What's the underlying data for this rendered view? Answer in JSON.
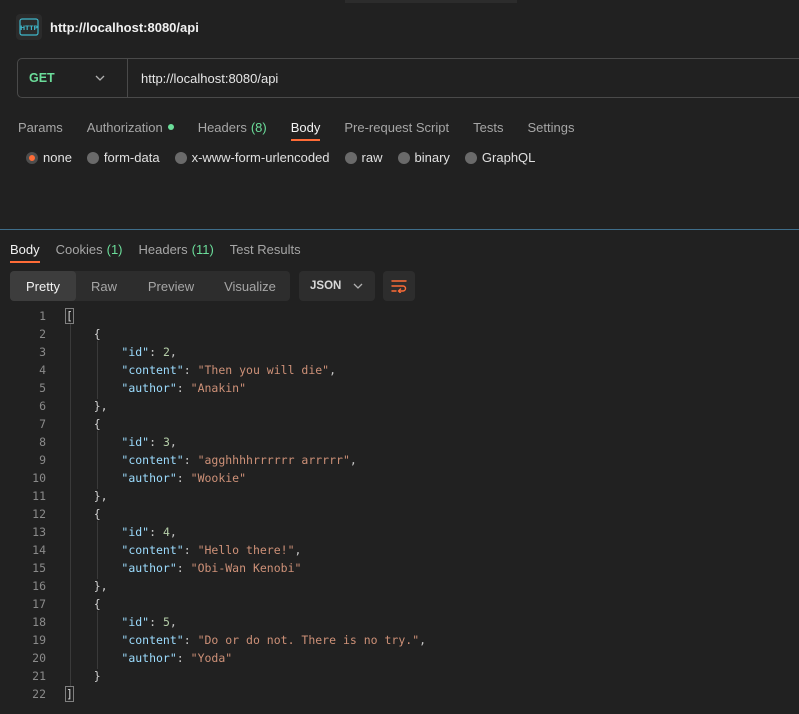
{
  "window": {
    "title": "http://localhost:8080/api",
    "icon": "http-icon"
  },
  "request": {
    "method": "GET",
    "url": "http://localhost:8080/api",
    "tabs": [
      {
        "label": "Params"
      },
      {
        "label": "Authorization",
        "indicator": "green-dot"
      },
      {
        "label": "Headers",
        "count": "(8)"
      },
      {
        "label": "Body",
        "active": true
      },
      {
        "label": "Pre-request Script"
      },
      {
        "label": "Tests"
      },
      {
        "label": "Settings"
      }
    ],
    "body_types": [
      {
        "label": "none",
        "checked": true
      },
      {
        "label": "form-data"
      },
      {
        "label": "x-www-form-urlencoded"
      },
      {
        "label": "raw"
      },
      {
        "label": "binary"
      },
      {
        "label": "GraphQL"
      }
    ]
  },
  "response": {
    "tabs": [
      {
        "label": "Body",
        "active": true
      },
      {
        "label": "Cookies",
        "count": "(1)"
      },
      {
        "label": "Headers",
        "count": "(11)"
      },
      {
        "label": "Test Results"
      }
    ],
    "view_modes": [
      "Pretty",
      "Raw",
      "Preview",
      "Visualize"
    ],
    "active_view": "Pretty",
    "format": "JSON",
    "lines": [
      {
        "n": "1",
        "text": "["
      },
      {
        "n": "2",
        "text": "    {"
      },
      {
        "n": "3",
        "key": "\"id\"",
        "num": "2",
        "indent": "        "
      },
      {
        "n": "4",
        "key": "\"content\"",
        "str": "\"Then you will die\"",
        "indent": "        "
      },
      {
        "n": "5",
        "key": "\"author\"",
        "str": "\"Anakin\"",
        "indent": "        ",
        "last": true
      },
      {
        "n": "6",
        "text": "    },"
      },
      {
        "n": "7",
        "text": "    {"
      },
      {
        "n": "8",
        "key": "\"id\"",
        "num": "3",
        "indent": "        "
      },
      {
        "n": "9",
        "key": "\"content\"",
        "str": "\"agghhhhrrrrrr arrrrr\"",
        "indent": "        "
      },
      {
        "n": "10",
        "key": "\"author\"",
        "str": "\"Wookie\"",
        "indent": "        ",
        "last": true
      },
      {
        "n": "11",
        "text": "    },"
      },
      {
        "n": "12",
        "text": "    {"
      },
      {
        "n": "13",
        "key": "\"id\"",
        "num": "4",
        "indent": "        "
      },
      {
        "n": "14",
        "key": "\"content\"",
        "str": "\"Hello there!\"",
        "indent": "        "
      },
      {
        "n": "15",
        "key": "\"author\"",
        "str": "\"Obi-Wan Kenobi\"",
        "indent": "        ",
        "last": true
      },
      {
        "n": "16",
        "text": "    },"
      },
      {
        "n": "17",
        "text": "    {"
      },
      {
        "n": "18",
        "key": "\"id\"",
        "num": "5",
        "indent": "        "
      },
      {
        "n": "19",
        "key": "\"content\"",
        "str": "\"Do or do not. There is no try.\"",
        "indent": "        "
      },
      {
        "n": "20",
        "key": "\"author\"",
        "str": "\"Yoda\"",
        "indent": "        ",
        "last": true
      },
      {
        "n": "21",
        "text": "    }"
      },
      {
        "n": "22",
        "text": "]"
      }
    ]
  },
  "colors": {
    "accent": "#ff6c37",
    "method_get": "#6bdd9a",
    "count": "#6bdd9a"
  }
}
